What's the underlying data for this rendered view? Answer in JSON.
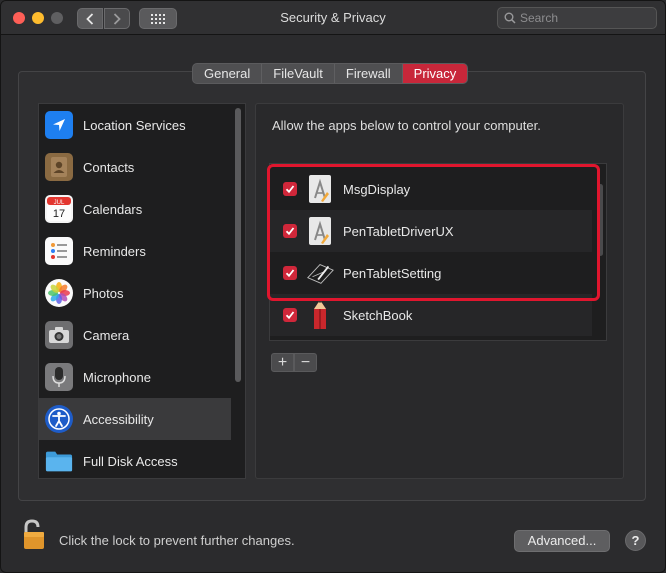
{
  "window": {
    "title": "Security & Privacy"
  },
  "search": {
    "placeholder": "Search",
    "value": ""
  },
  "tabs": [
    {
      "label": "General",
      "active": false
    },
    {
      "label": "FileVault",
      "active": false
    },
    {
      "label": "Firewall",
      "active": false
    },
    {
      "label": "Privacy",
      "active": true
    }
  ],
  "sidebar": {
    "items": [
      {
        "label": "Location Services",
        "icon": "location-arrow-icon",
        "selected": false
      },
      {
        "label": "Contacts",
        "icon": "contacts-book-icon",
        "selected": false
      },
      {
        "label": "Calendars",
        "icon": "calendar-icon",
        "selected": false,
        "icon_month": "JUL",
        "icon_day": "17"
      },
      {
        "label": "Reminders",
        "icon": "reminders-list-icon",
        "selected": false
      },
      {
        "label": "Photos",
        "icon": "photos-flower-icon",
        "selected": false
      },
      {
        "label": "Camera",
        "icon": "camera-icon",
        "selected": false
      },
      {
        "label": "Microphone",
        "icon": "microphone-icon",
        "selected": false
      },
      {
        "label": "Accessibility",
        "icon": "accessibility-icon",
        "selected": true
      },
      {
        "label": "Full Disk Access",
        "icon": "folder-icon",
        "selected": false
      }
    ]
  },
  "main": {
    "instruction": "Allow the apps below to control your computer.",
    "apps": [
      {
        "label": "MsgDisplay",
        "checked": true,
        "icon": "generic-app-icon"
      },
      {
        "label": "PenTabletDriverUX",
        "checked": true,
        "icon": "generic-app-icon"
      },
      {
        "label": "PenTabletSetting",
        "checked": true,
        "icon": "pen-tablet-icon"
      },
      {
        "label": "SketchBook",
        "checked": true,
        "icon": "pencil-app-icon"
      }
    ],
    "add_label": "+",
    "remove_label": "−"
  },
  "footer": {
    "lock_text": "Click the lock to prevent further changes.",
    "advanced_label": "Advanced...",
    "help_label": "?"
  },
  "colors": {
    "accent": "#c8273a",
    "checkbox": "#d0273a",
    "highlight": "#e0162e",
    "window_bg": "#2b2b2d"
  }
}
